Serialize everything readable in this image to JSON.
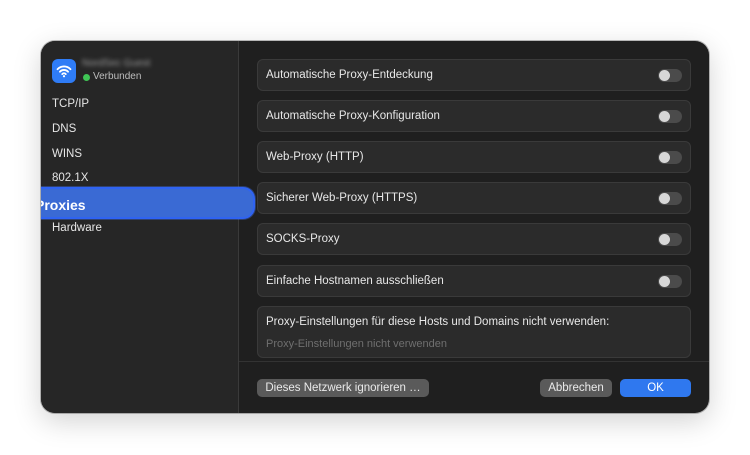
{
  "network": {
    "name": "NordSec Guest",
    "status": "Verbunden",
    "status_color": "#3fc555",
    "icon": "wifi-icon"
  },
  "sidebar": {
    "items": [
      {
        "label": "TCP/IP"
      },
      {
        "label": "DNS"
      },
      {
        "label": "WINS"
      },
      {
        "label": "802.1X"
      },
      {
        "label": "Proxies",
        "selected": true
      },
      {
        "label": "Hardware"
      }
    ]
  },
  "proxies": {
    "rows": [
      {
        "label": "Automatische Proxy-Entdeckung",
        "enabled": false
      },
      {
        "label": "Automatische Proxy-Konfiguration",
        "enabled": false
      },
      {
        "label": "Web-Proxy (HTTP)",
        "enabled": false
      },
      {
        "label": "Sicherer Web-Proxy (HTTPS)",
        "enabled": false
      },
      {
        "label": "SOCKS-Proxy",
        "enabled": false
      },
      {
        "label": "Einfache Hostnamen ausschließen",
        "enabled": false
      }
    ],
    "bypass_label": "Proxy-Einstellungen für diese Hosts und Domains nicht verwenden:",
    "bypass_placeholder": "Proxy-Einstellungen nicht verwenden",
    "bypass_value": ""
  },
  "footer": {
    "ignore_label": "Dieses Netzwerk ignorieren …",
    "cancel_label": "Abbrechen",
    "ok_label": "OK"
  },
  "colors": {
    "accent": "#2f78ef",
    "selection": "#3a6ad4"
  }
}
